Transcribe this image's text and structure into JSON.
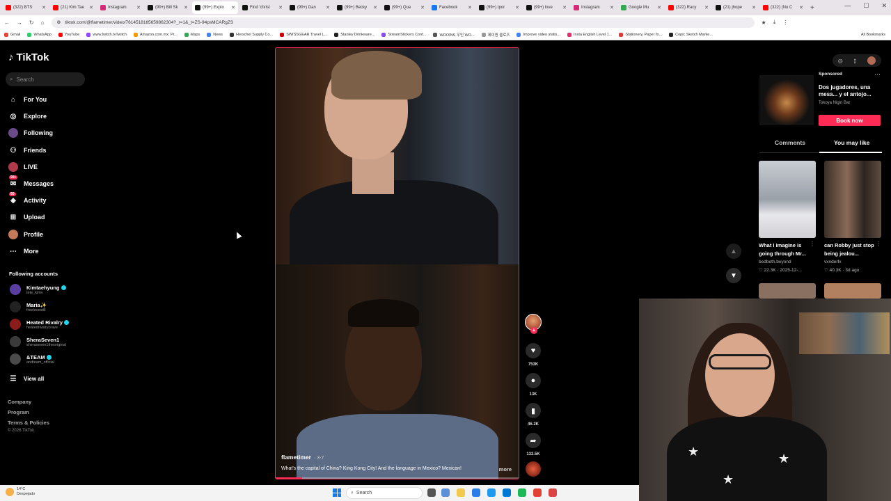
{
  "browser": {
    "tabs": [
      {
        "label": "(322) BTS",
        "color": "#ff0000"
      },
      {
        "label": "(21) Kim Tae",
        "color": "#ff0000"
      },
      {
        "label": "Instagram",
        "color": "#d62976"
      },
      {
        "label": "(99+) Bill Sk",
        "color": "#111111"
      },
      {
        "label": "(99+) Explo",
        "color": "#111111",
        "active": true
      },
      {
        "label": "Find 'christ",
        "color": "#111111"
      },
      {
        "label": "(99+) Dan",
        "color": "#111111"
      },
      {
        "label": "(99+) Becky",
        "color": "#111111"
      },
      {
        "label": "(99+) Que",
        "color": "#111111"
      },
      {
        "label": "Facebook",
        "color": "#1877f2"
      },
      {
        "label": "(99+) Ipor",
        "color": "#111111"
      },
      {
        "label": "(99+) love",
        "color": "#111111"
      },
      {
        "label": "Instagram",
        "color": "#d62976"
      },
      {
        "label": "Google Mu",
        "color": "#34a853"
      },
      {
        "label": "(322) Racy",
        "color": "#ff0000"
      },
      {
        "label": "(21) jhope",
        "color": "#111111"
      },
      {
        "label": "(322) (No C",
        "color": "#ff0000"
      }
    ],
    "url": "tiktok.com/@flametimer/video/7614518185659862304?_r=1&_t=ZS-94psMCARgZS",
    "bookmarks": [
      {
        "label": "Gmail",
        "color": "#ea4335"
      },
      {
        "label": "WhatsApp",
        "color": "#25d366"
      },
      {
        "label": "YouTube",
        "color": "#ff0000"
      },
      {
        "label": "www.twitch.tvTwitch",
        "color": "#9146ff"
      },
      {
        "label": "Amazon.com.mx: Pr...",
        "color": "#ff9900"
      },
      {
        "label": "Maps",
        "color": "#34a853"
      },
      {
        "label": "News",
        "color": "#4285f4"
      },
      {
        "label": "Herschel Supply Co...",
        "color": "#333333"
      },
      {
        "label": "SWISSGEAR Travel L...",
        "color": "#d00000"
      },
      {
        "label": "Stanley Drinkware...",
        "color": "#222222"
      },
      {
        "label": "StreamStickers Conf...",
        "color": "#8a4af3"
      },
      {
        "label": "WOOINS 우인 WO...",
        "color": "#555555"
      },
      {
        "label": "제이원 클로즈",
        "color": "#999999"
      },
      {
        "label": "Improve video statis...",
        "color": "#4285f4"
      },
      {
        "label": "Insta English Level 1...",
        "color": "#e1306c"
      },
      {
        "label": "Stationery, Paper fo...",
        "color": "#e53935"
      },
      {
        "label": "Copic Sketch Marke...",
        "color": "#222222"
      }
    ],
    "all_bookmarks": "All Bookmarks"
  },
  "sidebar": {
    "logo": "TikTok",
    "search_placeholder": "Search",
    "nav": [
      {
        "label": "For You",
        "icon": "home-icon"
      },
      {
        "label": "Explore",
        "icon": "compass-icon"
      },
      {
        "label": "Following",
        "icon": "avatar"
      },
      {
        "label": "Friends",
        "icon": "friends-icon"
      },
      {
        "label": "LIVE",
        "icon": "avatar"
      },
      {
        "label": "Messages",
        "icon": "inbox-icon",
        "badge": "99+"
      },
      {
        "label": "Activity",
        "icon": "activity-icon",
        "badge": "60"
      },
      {
        "label": "Upload",
        "icon": "upload-icon"
      },
      {
        "label": "Profile",
        "icon": "avatar"
      },
      {
        "label": "More",
        "icon": "more-icon"
      }
    ],
    "following_header": "Following accounts",
    "following": [
      {
        "name": "Kimtaehyung",
        "handle": "tete_kimv",
        "verified": true
      },
      {
        "name": "Maria✨",
        "handle": "freelovestill",
        "verified": false
      },
      {
        "name": "Heated Rivalry",
        "handle": "heatedrivalrycrave",
        "verified": true
      },
      {
        "name": "SheraSeven1",
        "handle": "sheraseven1theoriginal",
        "verified": false
      },
      {
        "name": "&TEAM",
        "handle": "andteam_official",
        "verified": true
      }
    ],
    "view_all": "View all",
    "footer": [
      "Company",
      "Program",
      "Terms & Policies"
    ],
    "copyright": "© 2026 TikTok"
  },
  "video": {
    "author": "flametimer",
    "date": "3-7",
    "caption": "What's the capital of China? King Kong City! And the language in Mexico? Mexican!",
    "more": "more",
    "progress": 0.11
  },
  "actions": {
    "likes": "753K",
    "comments": "13K",
    "saves": "46.2K",
    "shares": "132.5K"
  },
  "right_panel": {
    "ad": {
      "sponsored": "Sponsored",
      "title": "Dos jugadores, una mesa... y el antojo...",
      "sub": "Tokoya Nigiri Bar",
      "button": "Book now"
    },
    "tabs": [
      "Comments",
      "You may like"
    ],
    "active_tab": "You may like",
    "cards": [
      {
        "title": "What I imagine is going through Mr...",
        "user": "bedbeth.beyond",
        "likes": "22.3K",
        "date": "2025-12-..."
      },
      {
        "title": "can Robby just stop being jealou...",
        "user": "vxnderfx",
        "likes": "40.3K",
        "date": "3d ago"
      }
    ]
  },
  "taskbar": {
    "temp": "14°C",
    "weather": "Despejado",
    "search": "Search"
  },
  "colors": {
    "accent": "#fe2c55",
    "verified": "#20d5ec"
  }
}
